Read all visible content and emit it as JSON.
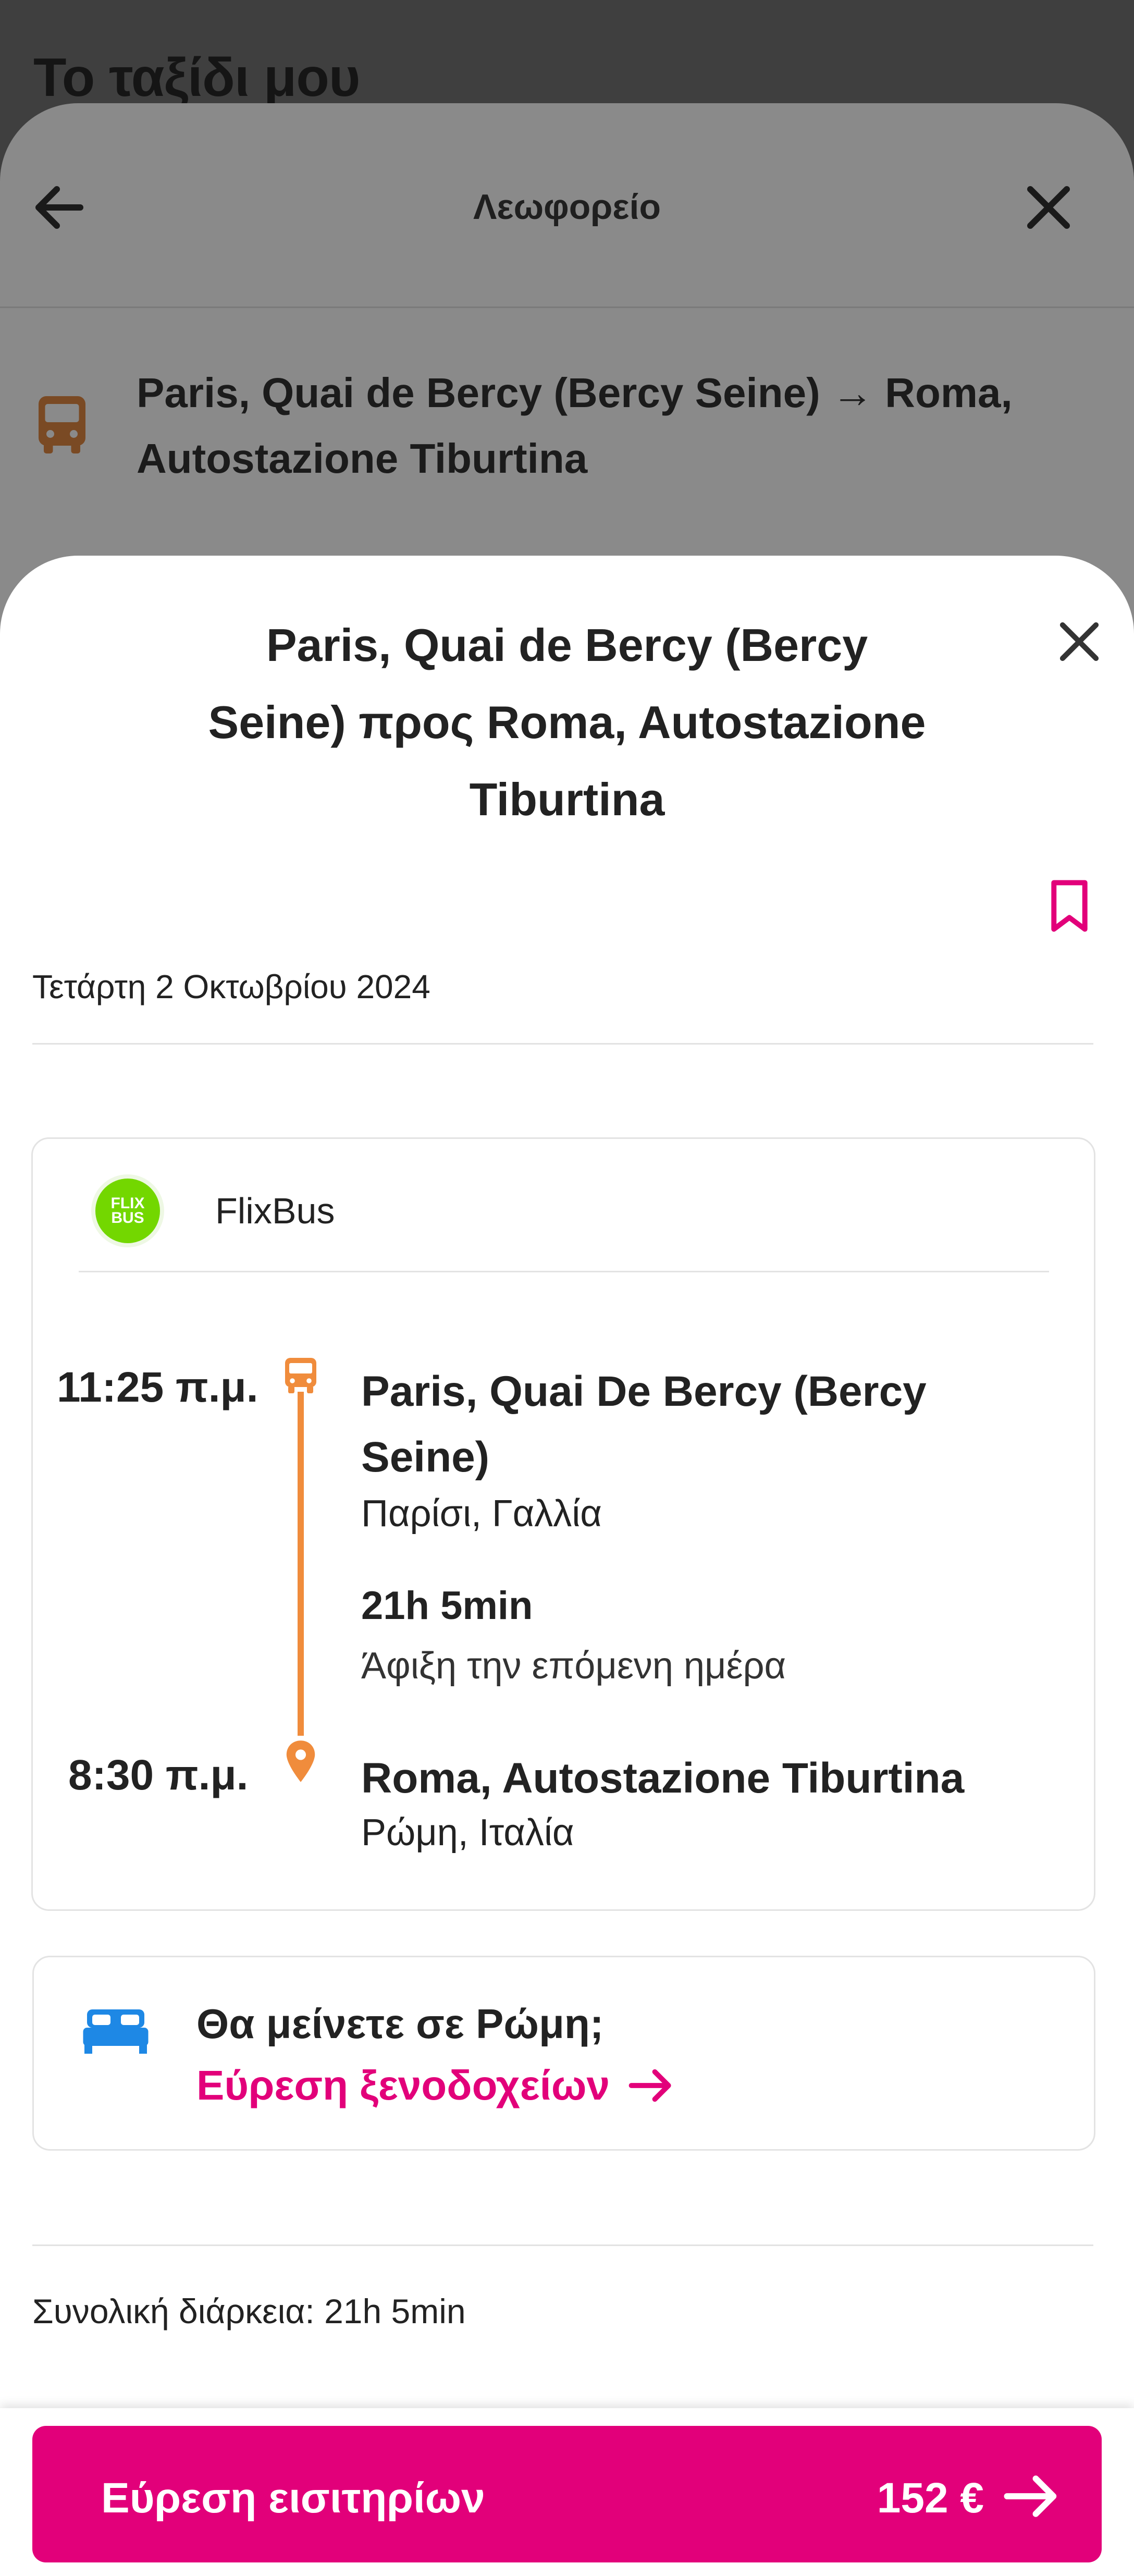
{
  "background_page": {
    "title": "Το ταξίδι μου"
  },
  "transport_sheet": {
    "title": "Λεωφορείο",
    "route": "Paris, Quai de Bercy (Bercy Seine) → Roma, Autostazione Tiburtina"
  },
  "route_sheet": {
    "title": "Paris, Quai de Bercy (Bercy Seine) προς Roma, Autostazione Tiburtina",
    "date": "Τετάρτη 2 Οκτωβρίου 2024",
    "itinerary": {
      "operator": "FlixBus",
      "logo_text": "FLIX BUS",
      "departure": {
        "time": "11:25 π.μ.",
        "stop": "Paris, Quai De Bercy (Bercy Seine)",
        "city": "Παρίσι, Γαλλία"
      },
      "duration": "21h 5min",
      "arrival_note": "Άφιξη την επόμενη ημέρα",
      "arrival": {
        "time": "8:30 π.μ.",
        "stop": "Roma, Autostazione Tiburtina",
        "city": "Ρώμη, Ιταλία"
      }
    },
    "hotel": {
      "question": "Θα μείνετε σε Ρώμη;",
      "link_label": "Εύρεση ξενοδοχείων"
    },
    "total_duration": "Συνολική διάρκεια: 21h 5min",
    "cta": {
      "label": "Εύρεση εισιτηρίων",
      "price": "152 €"
    }
  },
  "colors": {
    "accent": "#e2007a",
    "route_orange": "#f08c3c",
    "flixbus_green": "#73d700",
    "bed_blue": "#1e88e5"
  }
}
